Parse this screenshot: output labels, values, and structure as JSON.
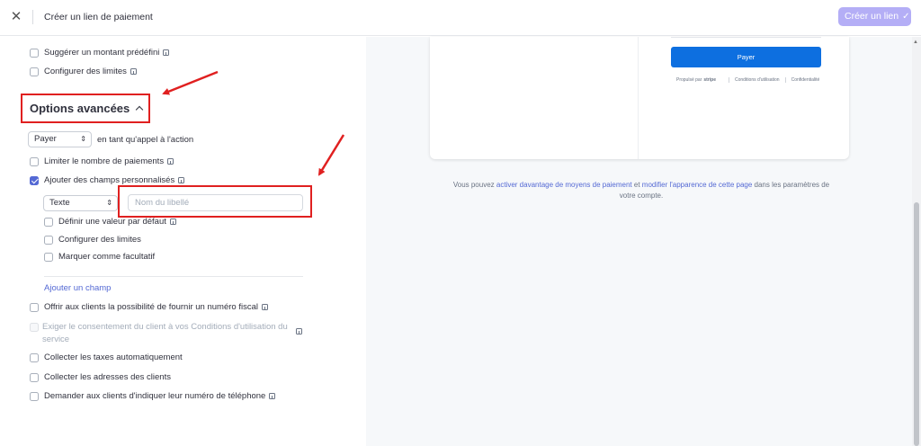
{
  "header": {
    "close_icon": "close-icon",
    "title": "Créer un lien de paiement",
    "create_button": "Créer un lien",
    "create_button_icon": "check-icon"
  },
  "left_panel": {
    "suggest_amount": "Suggérer un montant prédéfini",
    "configure_limits": "Configurer des limites",
    "advanced_title": "Options avancées",
    "cta_select": "Payer",
    "cta_suffix": "en tant qu'appel à l'action",
    "limit_payments": "Limiter le nombre de paiements",
    "custom_fields": "Ajouter des champs personnalisés",
    "custom_fields_checked": true,
    "field_type_select": "Texte",
    "label_placeholder": "Nom du libellé",
    "default_value": "Définir une valeur par défaut",
    "field_limits": "Configurer des limites",
    "optional": "Marquer comme facultatif",
    "add_field_link": "Ajouter un champ",
    "tax_id": "Offrir aux clients la possibilité de fournir un numéro fiscal",
    "terms_consent": "Exiger le consentement du client à vos Conditions d'utilisation du service",
    "auto_tax": "Collecter les taxes automatiquement",
    "addresses": "Collecter les adresses des clients",
    "phone": "Demander aux clients d'indiquer leur numéro de téléphone"
  },
  "preview": {
    "pay_button": "Payer",
    "powered_by": "Propulsé par",
    "stripe": "stripe",
    "terms": "Conditions d'utilisation",
    "privacy": "Confidentialité",
    "helper_before": "Vous pouvez",
    "helper_link1": "activer davantage de moyens de paiement",
    "helper_mid": "et",
    "helper_link2": "modifier l'apparence de cette page",
    "helper_after": "dans les paramètres de votre compte."
  },
  "colors": {
    "accent": "#5469d4",
    "primary_button_disabled": "#b4aef6",
    "pay_button": "#0d6fe0",
    "annotation_red": "#e02020"
  }
}
